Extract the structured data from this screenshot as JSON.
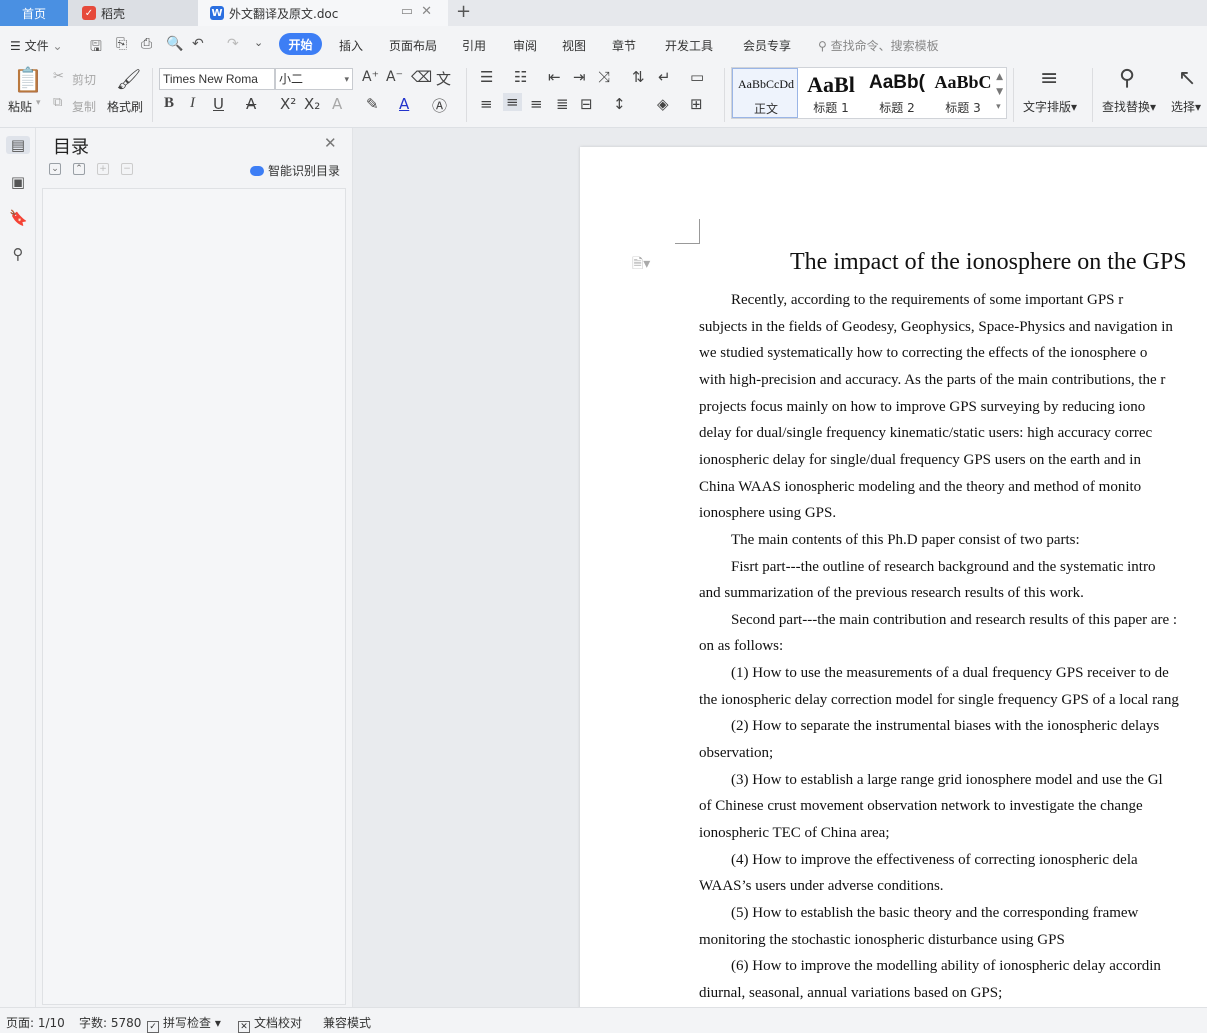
{
  "tabs": {
    "home": "首页",
    "daoke": "稻壳",
    "doc": "外文翻译及原文.doc",
    "add": "+"
  },
  "menu": {
    "file": "文件",
    "start": "开始",
    "items": [
      "插入",
      "页面布局",
      "引用",
      "审阅",
      "视图",
      "章节",
      "开发工具",
      "会员专享"
    ],
    "search_placeholder": "查找命令、搜索模板"
  },
  "ribbon": {
    "paste": "粘贴",
    "cut": "剪切",
    "copy": "复制",
    "format_painter": "格式刷",
    "font_name": "Times New Roma",
    "font_size": "小二",
    "styles": [
      {
        "sample": "AaBbCcDd",
        "name": "正文"
      },
      {
        "sample": "AaBl",
        "name": "标题 1"
      },
      {
        "sample": "AaBb(",
        "name": "标题 2"
      },
      {
        "sample": "AaBbC",
        "name": "标题 3"
      }
    ],
    "text_layout": "文字排版",
    "find_replace": "查找替换",
    "select": "选择"
  },
  "toc": {
    "title": "目录",
    "smart": "智能识别目录"
  },
  "document": {
    "title": "The impact of the ionosphere on the GPS",
    "lines": [
      {
        "text": "Recently, according to the requirements of some important GPS r",
        "indent": true
      },
      {
        "text": "subjects in the fields of Geodesy, Geophysics, Space-Physics and navigation in",
        "indent": false
      },
      {
        "text": "we studied systematically how to correcting the effects of the ionosphere o",
        "indent": false
      },
      {
        "text": "with high-precision and accuracy. As the parts of the main contributions, the r",
        "indent": false
      },
      {
        "text": "projects focus mainly on how to improve GPS surveying by reducing iono",
        "indent": false
      },
      {
        "text": "delay for dual/single frequency kinematic/static users: high accuracy correc",
        "indent": false
      },
      {
        "text": "ionospheric delay for single/dual frequency GPS users on the earth and in",
        "indent": false
      },
      {
        "text": "China WAAS ionospheric modeling and the theory and method of monito",
        "indent": false
      },
      {
        "text": "ionosphere using GPS.",
        "indent": false
      },
      {
        "text": "The main contents of this Ph.D paper consist of two parts:",
        "indent": true
      },
      {
        "text": "Fisrt part---the outline of research background and the systematic intro",
        "indent": true
      },
      {
        "text": "and summarization of the previous research results of this work.",
        "indent": false
      },
      {
        "text": "Second part---the main contribution and research results of this paper are :",
        "indent": true
      },
      {
        "text": "on as follows:",
        "indent": false
      },
      {
        "text": "(1) How to use the measurements of a dual frequency GPS receiver to de",
        "indent": true
      },
      {
        "text": "the ionospheric delay correction model for single frequency GPS of a local rang",
        "indent": false
      },
      {
        "text": "(2)  How to separate the instrumental biases with the ionospheric delays",
        "indent": true
      },
      {
        "text": "observation;",
        "indent": false
      },
      {
        "text": "(3) How to establish a large range grid ionosphere model and use the Gl",
        "indent": true
      },
      {
        "text": "of Chinese crust movement observation network to investigate the change",
        "indent": false
      },
      {
        "text": "ionospheric TEC of China area;",
        "indent": false
      },
      {
        "text": "(4)  How to improve the effectiveness of correcting ionospheric dela",
        "indent": true
      },
      {
        "text": "WAAS’s users under adverse conditions.",
        "indent": false
      },
      {
        "text": "(5)  How to establish the basic theory and the corresponding framew",
        "indent": true
      },
      {
        "text": "monitoring the stochastic ionospheric disturbance using GPS",
        "indent": false
      },
      {
        "text": "(6)  How to improve the modelling ability of ionospheric delay accordin",
        "indent": true
      },
      {
        "text": "diurnal, seasonal, annual variations based on GPS;",
        "indent": false
      }
    ]
  },
  "status": {
    "page": "页面: 1/10",
    "words": "字数: 5780",
    "spell": "拼写检查",
    "proof": "文档校对",
    "compat": "兼容模式"
  }
}
